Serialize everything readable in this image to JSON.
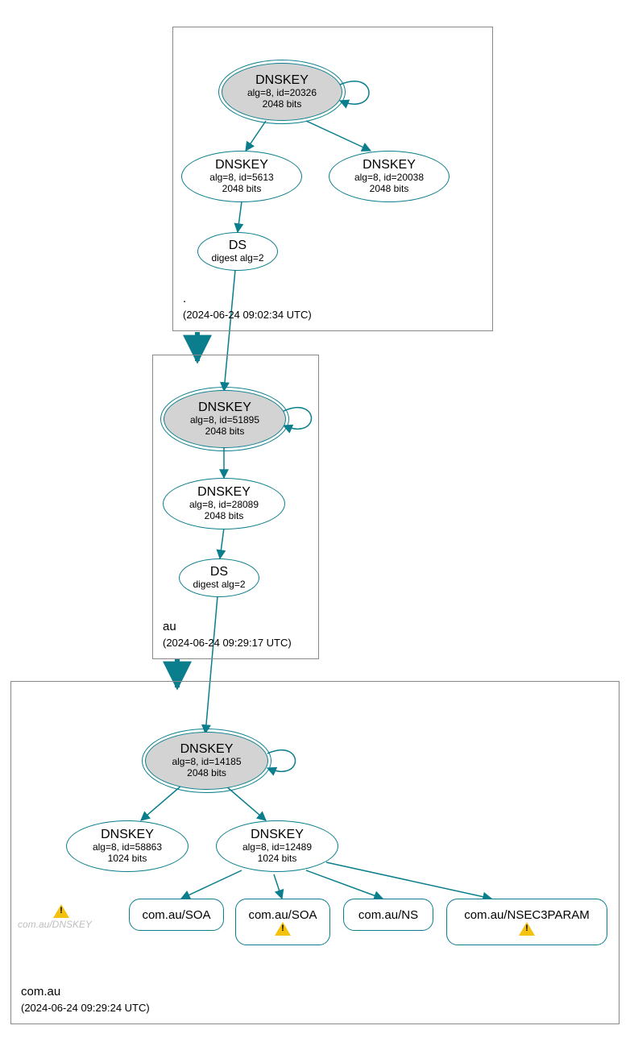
{
  "colors": {
    "stroke": "#0a7e8c",
    "ksk_fill": "#d3d3d3"
  },
  "zones": {
    "root": {
      "name": ".",
      "timestamp": "(2024-06-24 09:02:34 UTC)"
    },
    "au": {
      "name": "au",
      "timestamp": "(2024-06-24 09:29:17 UTC)"
    },
    "comau": {
      "name": "com.au",
      "timestamp": "(2024-06-24 09:29:24 UTC)"
    }
  },
  "nodes": {
    "root_ksk": {
      "title": "DNSKEY",
      "l1": "alg=8, id=20326",
      "l2": "2048 bits"
    },
    "root_zsk1": {
      "title": "DNSKEY",
      "l1": "alg=8, id=5613",
      "l2": "2048 bits"
    },
    "root_zsk2": {
      "title": "DNSKEY",
      "l1": "alg=8, id=20038",
      "l2": "2048 bits"
    },
    "root_ds": {
      "title": "DS",
      "l1": "digest alg=2"
    },
    "au_ksk": {
      "title": "DNSKEY",
      "l1": "alg=8, id=51895",
      "l2": "2048 bits"
    },
    "au_zsk": {
      "title": "DNSKEY",
      "l1": "alg=8, id=28089",
      "l2": "2048 bits"
    },
    "au_ds": {
      "title": "DS",
      "l1": "digest alg=2"
    },
    "comau_ksk": {
      "title": "DNSKEY",
      "l1": "alg=8, id=14185",
      "l2": "2048 bits"
    },
    "comau_zsk1": {
      "title": "DNSKEY",
      "l1": "alg=8, id=58863",
      "l2": "1024 bits"
    },
    "comau_zsk2": {
      "title": "DNSKEY",
      "l1": "alg=8, id=12489",
      "l2": "1024 bits"
    }
  },
  "rr": {
    "soa1": "com.au/SOA",
    "soa2": "com.au/SOA",
    "ns": "com.au/NS",
    "nsec3": "com.au/NSEC3PARAM"
  },
  "ghost": "com.au/DNSKEY"
}
